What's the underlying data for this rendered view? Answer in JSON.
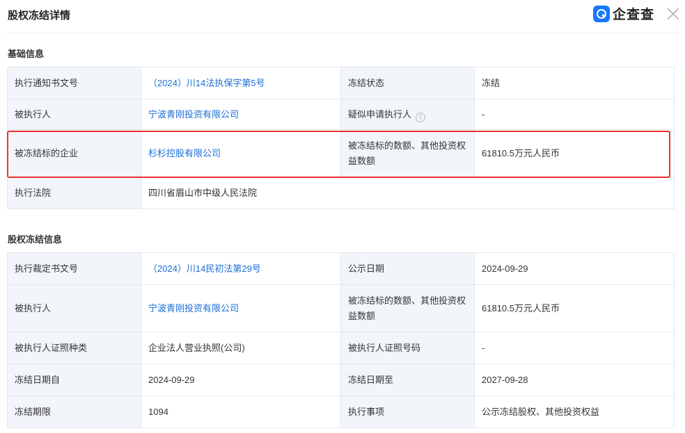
{
  "header": {
    "title": "股权冻结详情",
    "brand": "企查查"
  },
  "basic": {
    "section_title": "基础信息",
    "rows": [
      {
        "l1": "执行通知书文号",
        "v1": "（2024）川14法执保字第5号",
        "l2": "冻结状态",
        "v2": "冻结"
      },
      {
        "l1": "被执行人",
        "v1": "宁波青刚投资有限公司",
        "l2": "疑似申请执行人",
        "v2": "-"
      },
      {
        "l1": "被冻结标的企业",
        "v1": "杉杉控股有限公司",
        "l2": "被冻结标的数额、其他投资权益数额",
        "v2": "61810.5万元人民币"
      },
      {
        "l1": "执行法院",
        "v1": "四川省眉山市中级人民法院"
      }
    ]
  },
  "freeze": {
    "section_title": "股权冻结信息",
    "rows": [
      {
        "l1": "执行裁定书文号",
        "v1": "（2024）川14民初法第29号",
        "l2": "公示日期",
        "v2": "2024-09-29"
      },
      {
        "l1": "被执行人",
        "v1": "宁波青刚投资有限公司",
        "l2": "被冻结标的数额、其他投资权益数额",
        "v2": "61810.5万元人民币"
      },
      {
        "l1": "被执行人证照种类",
        "v1": "企业法人营业执照(公司)",
        "l2": "被执行人证照号码",
        "v2": "-"
      },
      {
        "l1": "冻结日期自",
        "v1": "2024-09-29",
        "l2": "冻结日期至",
        "v2": "2027-09-28"
      },
      {
        "l1": "冻结期限",
        "v1": "1094",
        "l2": "执行事项",
        "v2": "公示冻结股权、其他投资权益"
      }
    ]
  },
  "colors": {
    "link": "#1a6fd8",
    "label_bg": "#f2f6fb",
    "highlight": "#e8322d",
    "brand": "#1677ff"
  },
  "icons": {
    "info": "info-circle-icon",
    "close": "close-icon",
    "logo": "qichacha-logo-icon"
  }
}
